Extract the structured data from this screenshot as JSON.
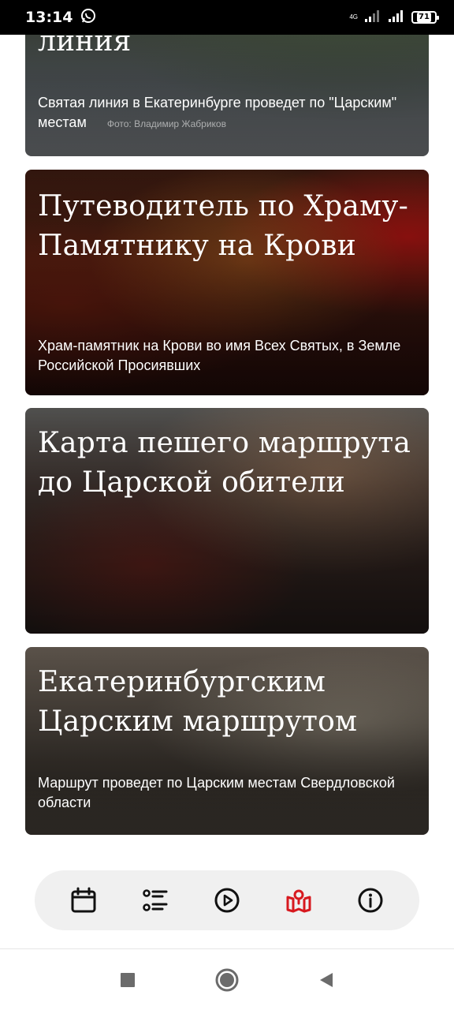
{
  "status_bar": {
    "time": "13:14",
    "network": "4G",
    "battery": "71",
    "icons": [
      "whatsapp-icon",
      "signal-icon",
      "battery-icon"
    ]
  },
  "feed": {
    "cards": [
      {
        "title": "линия",
        "subtitle": "Святая линия в Екатеринбурге проведет по \"Царским\" местам",
        "credit": "Фото: Владимир Жабриков"
      },
      {
        "title": "Путеводитель по Храму-Памятнику на Крови",
        "subtitle": "Храм-памятник на Крови во имя Всех Святых, в Земле Российской Просиявших"
      },
      {
        "title": "Карта пешего маршрута до Царской обители"
      },
      {
        "title": "Екатеринбургским Царским маршрутом",
        "subtitle": "Маршрут проведет по Царским местам Свердловской области"
      }
    ]
  },
  "bottom_nav": {
    "items": [
      {
        "icon": "calendar-icon",
        "active": false
      },
      {
        "icon": "list-icon",
        "active": false
      },
      {
        "icon": "play-circle-icon",
        "active": false
      },
      {
        "icon": "map-pin-icon",
        "active": true
      },
      {
        "icon": "info-icon",
        "active": false
      }
    ],
    "colors": {
      "active": "#d7191f",
      "inactive": "#111111",
      "background": "#f0f0f0"
    }
  },
  "system_nav": {
    "icons": [
      "recent-apps-icon",
      "home-icon",
      "back-icon"
    ]
  }
}
